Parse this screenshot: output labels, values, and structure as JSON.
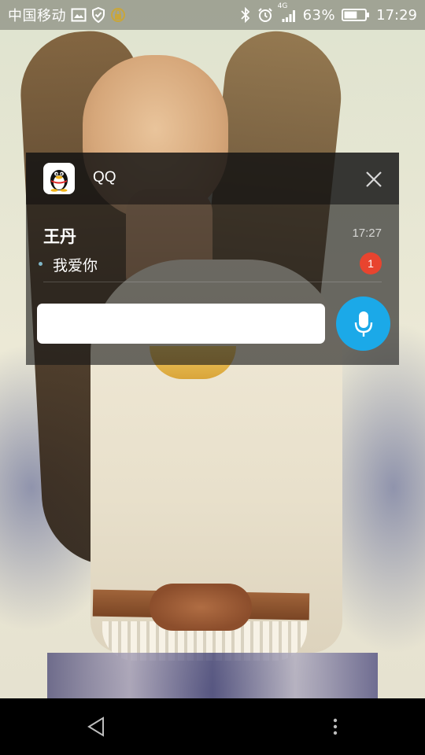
{
  "status_bar": {
    "carrier": "中国移动",
    "network_type": "4G",
    "battery_percent": "63%",
    "battery_level": 0.63,
    "time": "17:29",
    "icons": [
      "image-icon",
      "shield-icon",
      "lock-icon",
      "bluetooth-icon",
      "alarm-icon",
      "signal-icon",
      "battery-icon"
    ]
  },
  "notification": {
    "app_name": "QQ",
    "app_icon": "qq-penguin-icon",
    "sender": "王丹",
    "time": "17:27",
    "message": "我爱你",
    "unread_count": "1",
    "reply_value": "",
    "close_icon": "close-icon",
    "voice_icon": "microphone-icon"
  },
  "nav_bar": {
    "icons": [
      "back-icon",
      "menu-dots-icon"
    ]
  },
  "colors": {
    "voice_button": "#1ba9e8",
    "badge": "#e8442f",
    "card_background": "rgba(24,24,24,0.62)"
  }
}
